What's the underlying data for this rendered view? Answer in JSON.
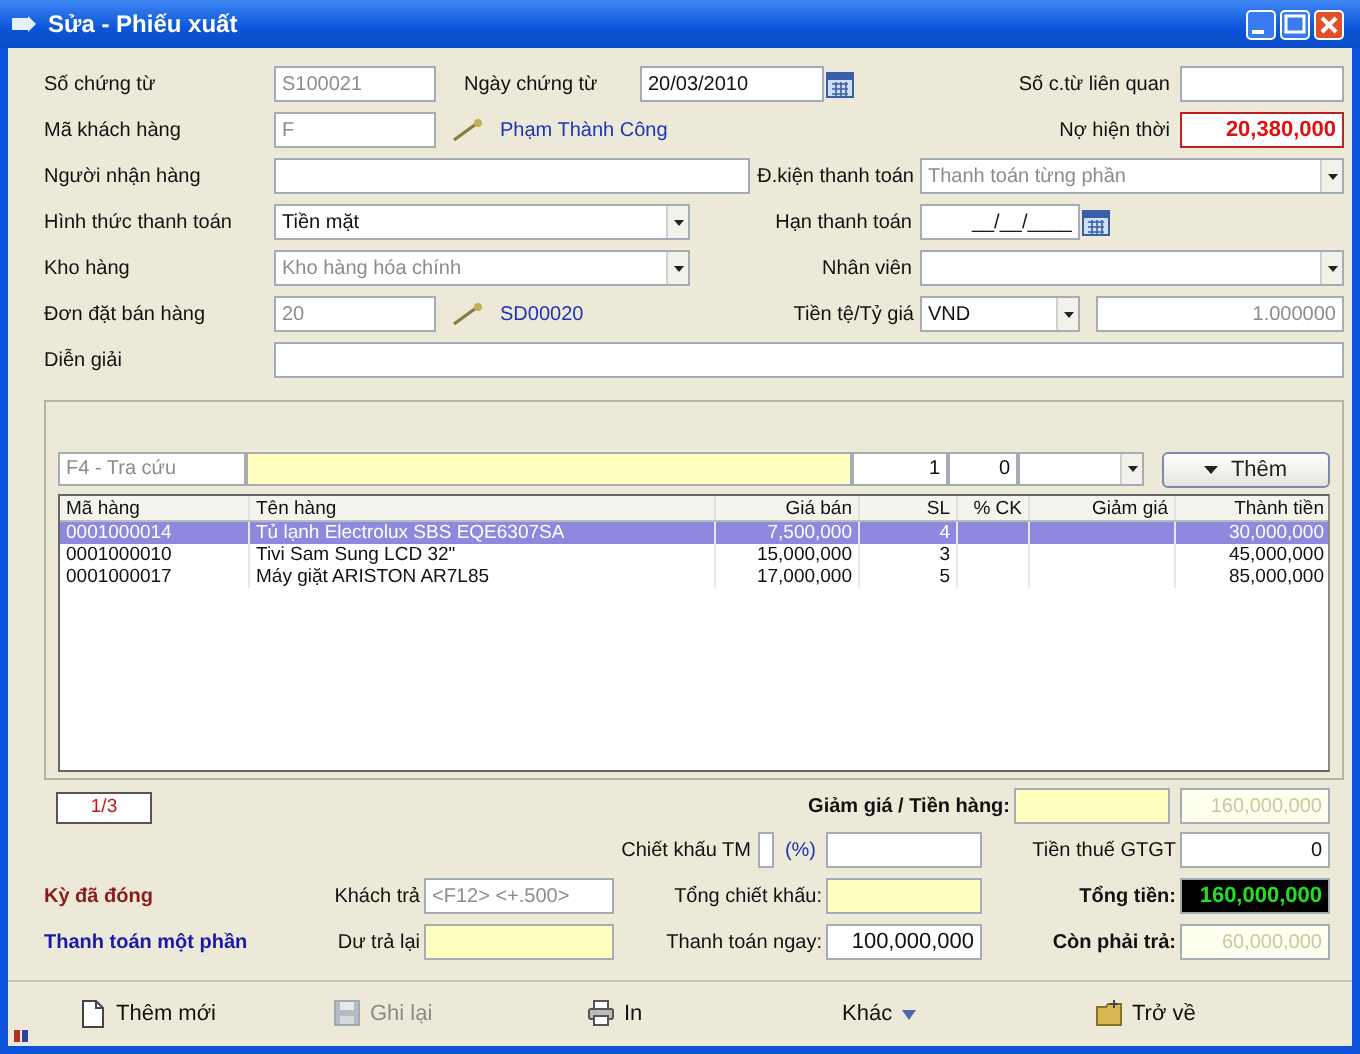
{
  "window": {
    "title": "Sửa - Phiếu xuất"
  },
  "form": {
    "document_number": {
      "label": "Số chứng từ",
      "value": "S100021",
      "disabled": true
    },
    "document_date": {
      "label": "Ngày chứng từ",
      "value": "20/03/2010",
      "disabled": false
    },
    "related_document": {
      "label": "Số c.từ liên quan"
    },
    "customer_code": {
      "label": "Mã khách hàng",
      "value": "F",
      "disabled": true,
      "link": "Phạm Thành Công"
    },
    "current_debt": {
      "label": "Nợ hiện thời",
      "value": "20,380,000",
      "disabled": false
    },
    "recipient": {
      "label": "Người nhận hàng"
    },
    "payment_terms": {
      "label": "Đ.kiện thanh toán",
      "value": "Thanh toán từng phần",
      "disabled": true
    },
    "payment_method": {
      "label": "Hình thức thanh toán",
      "value": "Tiền mặt",
      "disabled": false
    },
    "payment_due": {
      "label": "Hạn thanh toán",
      "value": "__/__/____",
      "disabled": false
    },
    "warehouse": {
      "label": "Kho hàng",
      "value": "Kho hàng hóa chính",
      "disabled": true
    },
    "employee": {
      "label": "Nhân viên"
    },
    "sales_order": {
      "label": "Đơn đặt bán hàng",
      "value": "20",
      "disabled": true,
      "link": "SD00020"
    },
    "currency": {
      "label": "Tiền tệ/Tỷ giá",
      "value": "VND",
      "disabled": false
    },
    "exchange_rate": {
      "value": "1.000000",
      "disabled": true
    },
    "description": {
      "label": "Diễn giải"
    }
  },
  "item_entry": {
    "search": {
      "placeholder": "F4 - Tra cứu"
    },
    "quantity": "1",
    "discount_percent": "0",
    "add_button": "Thêm"
  },
  "table": {
    "columns": [
      "Mã hàng",
      "Tên hàng",
      "Giá bán",
      "SL",
      "% CK",
      "Giảm giá",
      "Thành tiền"
    ],
    "rows": [
      {
        "code": "0001000014",
        "name": "Tủ lạnh Electrolux SBS EQE6307SA",
        "price": "7,500,000",
        "qty": "4",
        "total": "30,000,000",
        "selected": true
      },
      {
        "code": "0001000010",
        "name": "Tivi Sam Sung LCD 32\"",
        "price": "15,000,000",
        "qty": "3",
        "total": "45,000,000",
        "selected": false
      },
      {
        "code": "0001000017",
        "name": "Máy giặt ARISTON AR7L85",
        "price": "17,000,000",
        "qty": "5",
        "total": "85,000,000",
        "selected": false
      }
    ]
  },
  "pager": "1/3",
  "statuses": [
    {
      "text": "Kỳ đã đóng",
      "color": "#8b1a1a"
    },
    {
      "text": "Thanh toán một phần",
      "color": "#1a1aa8"
    }
  ],
  "payment": {
    "customer_paid": {
      "label": "Khách trả",
      "placeholder": "<F12> <+.500>"
    },
    "change": {
      "label": "Dư trả lại"
    }
  },
  "totals": {
    "discount_subtotal": {
      "label": "Giảm giá / Tiền hàng:",
      "value": "160,000,000"
    },
    "cash_discount": {
      "label": "Chiết khấu TM",
      "unit": "(%)"
    },
    "vat": {
      "label": "Tiền thuế GTGT",
      "value": "0"
    },
    "total_discount": {
      "label": "Tổng chiết khấu:"
    },
    "grand_total": {
      "label": "Tổng tiền:",
      "value": "160,000,000"
    },
    "paid_now": {
      "label": "Thanh toán ngay:",
      "value": "100,000,000"
    },
    "remaining": {
      "label": "Còn phải trả:",
      "value": "60,000,000"
    }
  },
  "toolbar": [
    {
      "label": "Thêm mới",
      "kind": "document",
      "disabled": false
    },
    {
      "label": "Ghi lại",
      "kind": "save",
      "disabled": true
    },
    {
      "label": "In",
      "kind": "printer",
      "disabled": false
    },
    {
      "label": "Khác",
      "kind": "menu",
      "disabled": false
    },
    {
      "label": "Trở về",
      "kind": "folder",
      "disabled": false
    }
  ]
}
